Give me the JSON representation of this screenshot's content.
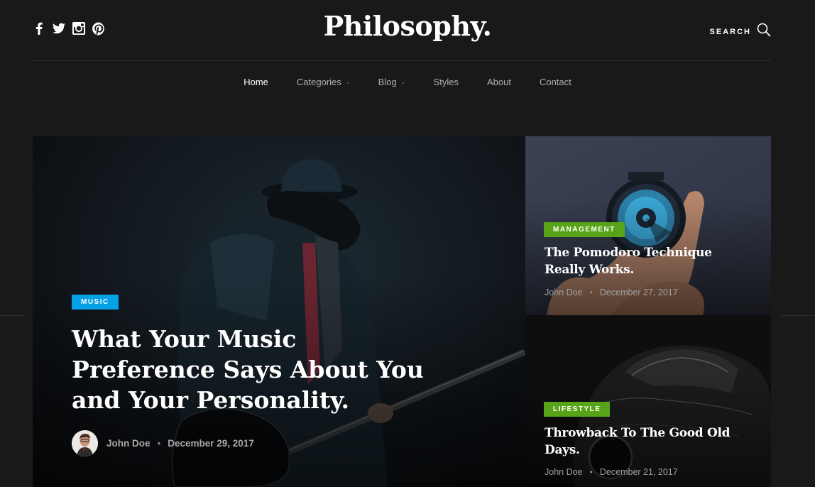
{
  "header": {
    "logo": "Philosophy.",
    "search_label": "SEARCH",
    "social": [
      "facebook-icon",
      "twitter-icon",
      "instagram-icon",
      "pinterest-icon"
    ]
  },
  "nav": {
    "items": [
      {
        "label": "Home",
        "active": true,
        "dropdown": false
      },
      {
        "label": "Categories",
        "active": false,
        "dropdown": true
      },
      {
        "label": "Blog",
        "active": false,
        "dropdown": true
      },
      {
        "label": "Styles",
        "active": false,
        "dropdown": false
      },
      {
        "label": "About",
        "active": false,
        "dropdown": false
      },
      {
        "label": "Contact",
        "active": false,
        "dropdown": false
      }
    ],
    "caret": "⌄"
  },
  "featured": {
    "category": "MUSIC",
    "category_color": "#04a1e6",
    "title": "What Your Music Preference Says About You and Your Personality.",
    "author": "John Doe",
    "separator": "•",
    "date": "December 29, 2017"
  },
  "cards": [
    {
      "category": "MANAGEMENT",
      "category_color": "#57a418",
      "title": "The Pomodoro Technique Really Works.",
      "author": "John Doe",
      "separator": "•",
      "date": "December 27, 2017"
    },
    {
      "category": "LIFESTYLE",
      "category_color": "#57a418",
      "title": "Throwback To The Good Old Days.",
      "author": "John Doe",
      "separator": "•",
      "date": "December 21, 2017"
    }
  ]
}
